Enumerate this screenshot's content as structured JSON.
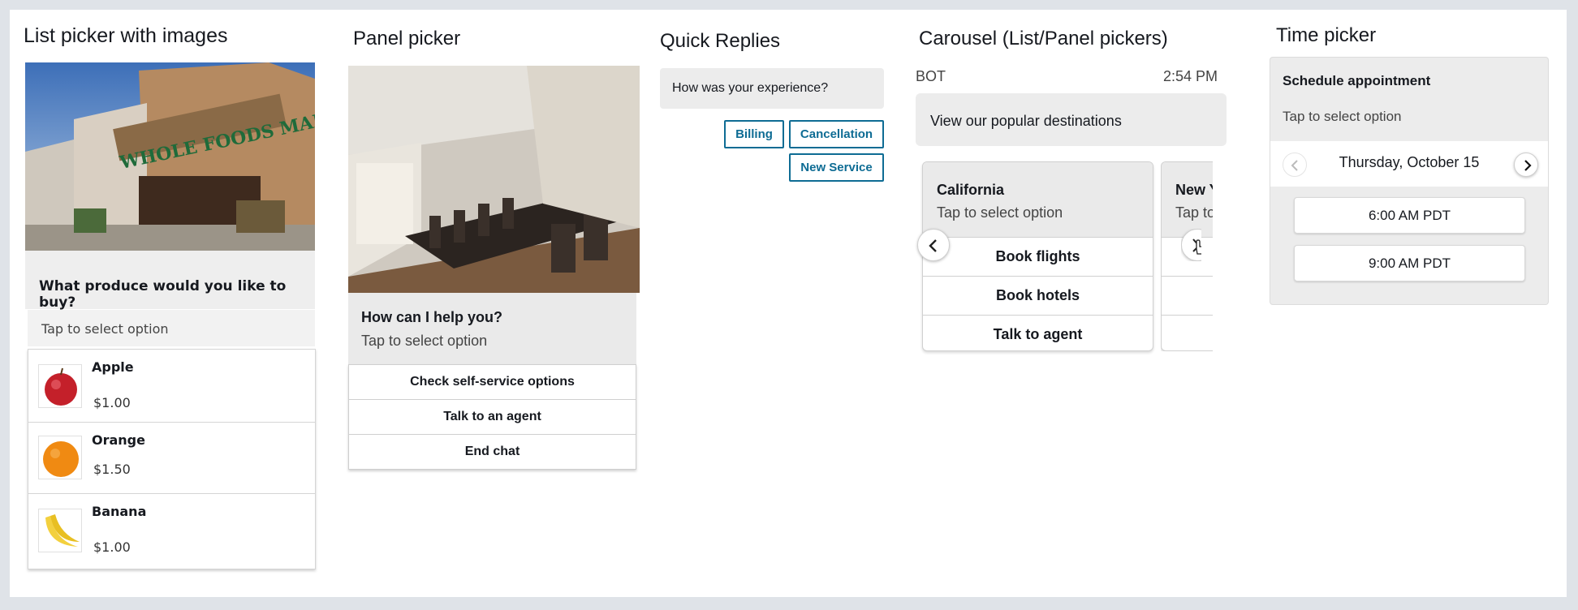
{
  "list_picker": {
    "title": "List picker with images",
    "question": "What produce would you like to buy?",
    "tap": "Tap to select option",
    "items": [
      {
        "name": "Apple",
        "price": "$1.00"
      },
      {
        "name": "Orange",
        "price": "$1.50"
      },
      {
        "name": "Banana",
        "price": "$1.00"
      }
    ]
  },
  "panel_picker": {
    "title": "Panel picker",
    "heading": "How can I help you?",
    "tap": "Tap to select option",
    "options": [
      "Check self-service options",
      "Talk to an agent",
      "End chat"
    ]
  },
  "quick_replies": {
    "title": "Quick Replies",
    "message": "How was your experience?",
    "buttons": [
      "Billing",
      "Cancellation",
      "New Service"
    ]
  },
  "carousel": {
    "title": "Carousel (List/Panel pickers)",
    "sender": "BOT",
    "time": "2:54 PM",
    "message": "View our popular destinations",
    "cards": [
      {
        "title": "California",
        "subtitle": "Tap to select option",
        "options": [
          "Book flights",
          "Book hotels",
          "Talk to agent"
        ]
      },
      {
        "title": "New Y",
        "subtitle": "Tap to"
      }
    ]
  },
  "time_picker": {
    "title": "Time picker",
    "heading": "Schedule appointment",
    "tap": "Tap to select option",
    "date": "Thursday, October 15",
    "slots": [
      "6:00 AM PDT",
      "9:00 AM PDT"
    ]
  },
  "icons": [
    "chevron-left-icon",
    "chevron-right-icon",
    "hand-pointer-icon"
  ],
  "colors": {
    "accent": "#0e6c94",
    "card_bg": "#ececec",
    "border": "#d0d0d0"
  }
}
